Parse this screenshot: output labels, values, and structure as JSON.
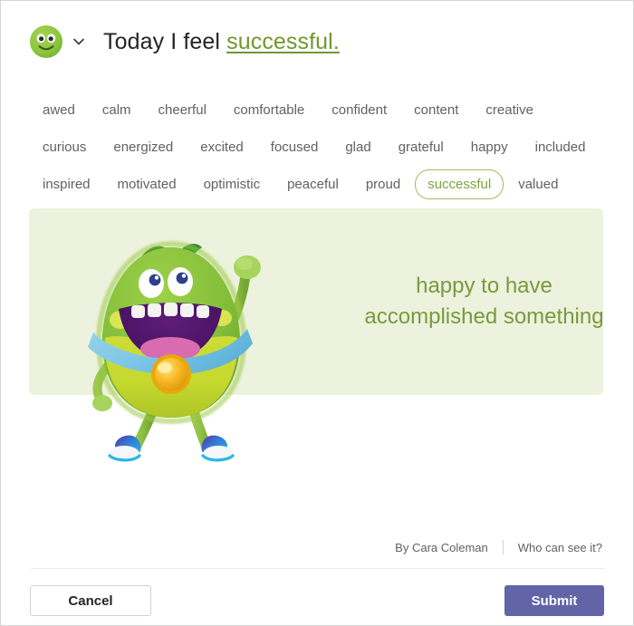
{
  "dialog": {
    "title": "Today I feel successful."
  },
  "header": {
    "avatar_icon": "green-smiley-face-icon",
    "chevron_icon": "chevron-down-icon",
    "prefix_text": "Today I feel ",
    "mood_link": "successful.",
    "mood_link_color": "#72972e"
  },
  "words": [
    {
      "label": "awed",
      "selected": false
    },
    {
      "label": "calm",
      "selected": false
    },
    {
      "label": "cheerful",
      "selected": false
    },
    {
      "label": "comfortable",
      "selected": false
    },
    {
      "label": "confident",
      "selected": false
    },
    {
      "label": "content",
      "selected": false
    },
    {
      "label": "creative",
      "selected": false
    },
    {
      "label": "curious",
      "selected": false
    },
    {
      "label": "energized",
      "selected": false
    },
    {
      "label": "excited",
      "selected": false
    },
    {
      "label": "focused",
      "selected": false
    },
    {
      "label": "glad",
      "selected": false
    },
    {
      "label": "grateful",
      "selected": false
    },
    {
      "label": "happy",
      "selected": false
    },
    {
      "label": "included",
      "selected": false
    },
    {
      "label": "inspired",
      "selected": false
    },
    {
      "label": "motivated",
      "selected": false
    },
    {
      "label": "optimistic",
      "selected": false
    },
    {
      "label": "peaceful",
      "selected": false
    },
    {
      "label": "proud",
      "selected": false
    },
    {
      "label": "successful",
      "selected": true
    },
    {
      "label": "valued",
      "selected": false
    }
  ],
  "card": {
    "background_color": "#edf2de",
    "text_color": "#7a9a3c",
    "caption_line_1": "happy to have",
    "caption_line_2": "accomplished something",
    "illustration_name": "green-furry-monster-with-medal-illustration"
  },
  "byline": {
    "author": "By Cara Coleman",
    "privacy_link": "Who can see it?"
  },
  "footer": {
    "cancel_label": "Cancel",
    "submit_label": "Submit",
    "submit_color": "#6264a7"
  }
}
